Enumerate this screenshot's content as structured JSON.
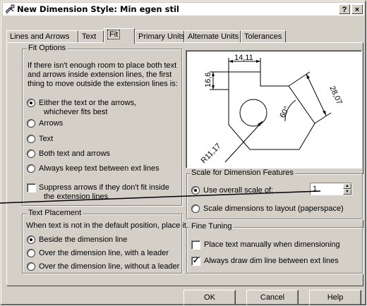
{
  "window": {
    "title": "New Dimension Style: Min egen stil",
    "help_btn": "?",
    "close_btn": "×"
  },
  "tabs": [
    "Lines and Arrows",
    "Text",
    "Fit",
    "Primary Units",
    "Alternate Units",
    "Tolerances"
  ],
  "fit_options": {
    "label": "Fit Options",
    "description": [
      "If there isn't enough room to place both text",
      "and arrows inside extension lines, the first",
      "thing to move outside the extension lines is:"
    ],
    "radios": [
      {
        "label": "Either the text or the arrows,",
        "label2": "whichever fits best",
        "selected": true
      },
      {
        "label": "Arrows",
        "selected": false
      },
      {
        "label": "Text",
        "selected": false
      },
      {
        "label": "Both text and arrows",
        "selected": false
      },
      {
        "label": "Always keep text between ext lines",
        "selected": false
      }
    ],
    "suppress": {
      "label": "Suppress arrows if they don't fit inside",
      "label2": "the extension lines",
      "checked": false
    }
  },
  "text_placement": {
    "label": "Text Placement",
    "description": "When text is not in the default position, place it",
    "radios": [
      {
        "label": "Beside the dimension line",
        "selected": true
      },
      {
        "label": "Over the dimension line, with a leader",
        "selected": false
      },
      {
        "label": "Over the dimension line, without a leader",
        "selected": false
      }
    ]
  },
  "preview": {
    "dim_top": "14,11",
    "dim_left": "16,6",
    "dim_right": "28,07",
    "dim_angle": "60°",
    "dim_radius": "R11,17"
  },
  "scale": {
    "label": "Scale for Dimension Features",
    "overall": {
      "label": "Use overall scale of:",
      "selected": true,
      "value": "1"
    },
    "layout": {
      "label": "Scale dimensions to layout (paperspace)",
      "selected": false
    }
  },
  "fine_tuning": {
    "label": "Fine Tuning",
    "place_manual": {
      "label": "Place text manually when dimensioning",
      "checked": false
    },
    "always_draw": {
      "label": "Always draw dim line between ext lines",
      "checked": true
    }
  },
  "buttons": {
    "ok": "OK",
    "cancel": "Cancel",
    "help": "Help"
  }
}
